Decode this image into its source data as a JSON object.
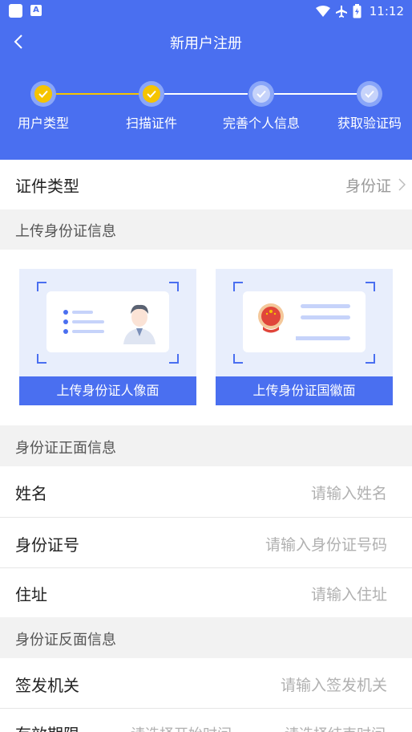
{
  "status_bar": {
    "time": "11:12",
    "left_icons": [
      "app-icon",
      "font-icon"
    ],
    "right_icons": [
      "wifi-icon",
      "airplane-icon",
      "battery-icon"
    ]
  },
  "header": {
    "title": "新用户注册",
    "steps": [
      {
        "label": "用户类型",
        "done": true
      },
      {
        "label": "扫描证件",
        "done": true
      },
      {
        "label": "完善个人信息",
        "done": false
      },
      {
        "label": "获取验证码",
        "done": false
      }
    ]
  },
  "cert_type": {
    "label": "证件类型",
    "value": "身份证"
  },
  "upload_section": {
    "title": "上传身份证信息",
    "front_button": "上传身份证人像面",
    "back_button": "上传身份证国徽面"
  },
  "front_info": {
    "title": "身份证正面信息",
    "name_label": "姓名",
    "name_placeholder": "请输入姓名",
    "id_label": "身份证号",
    "id_placeholder": "请输入身份证号码",
    "address_label": "住址",
    "address_placeholder": "请输入住址"
  },
  "back_info": {
    "title": "身份证反面信息",
    "authority_label": "签发机关",
    "authority_placeholder": "请输入签发机关",
    "validity_label": "有效期限",
    "validity_start": "请选择开始时间",
    "validity_end": "请选择结束时间"
  },
  "colors": {
    "primary": "#4a6ff0",
    "step_done": "#f5c400",
    "background": "#f2f2f2"
  }
}
